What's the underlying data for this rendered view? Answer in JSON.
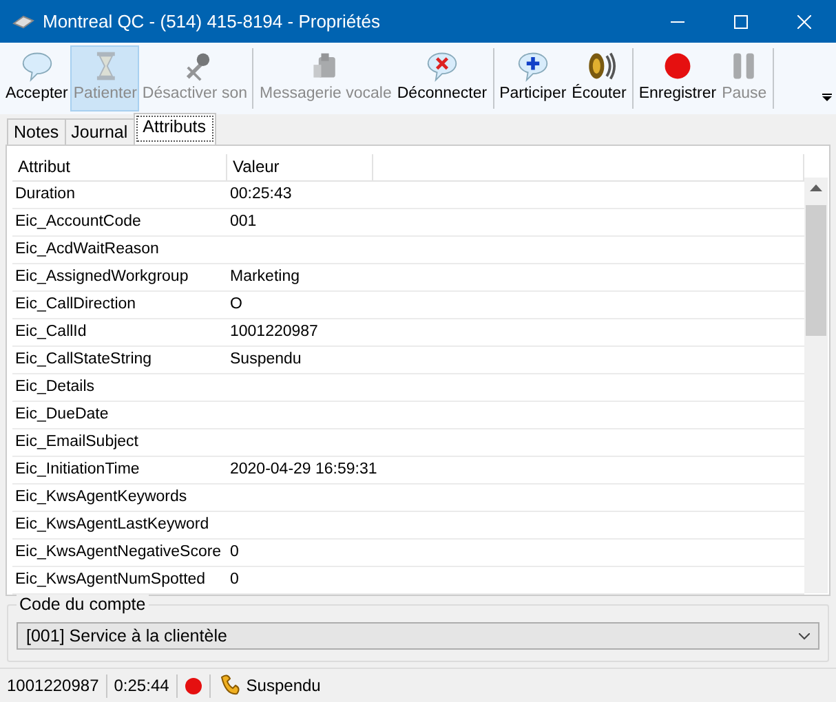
{
  "window": {
    "title": "Montreal QC - (514) 415-8194 - Propriétés"
  },
  "toolbar": [
    {
      "label": "Accepter",
      "disabled": false,
      "pressed": false,
      "separator_after": false
    },
    {
      "label": "Patienter",
      "disabled": true,
      "pressed": true,
      "separator_after": false
    },
    {
      "label": "Désactiver son",
      "disabled": true,
      "pressed": false,
      "separator_after": true
    },
    {
      "label": "Messagerie vocale",
      "disabled": true,
      "pressed": false,
      "separator_after": false
    },
    {
      "label": "Déconnecter",
      "disabled": false,
      "pressed": false,
      "separator_after": true
    },
    {
      "label": "Participer",
      "disabled": false,
      "pressed": false,
      "separator_after": false
    },
    {
      "label": "Écouter",
      "disabled": false,
      "pressed": false,
      "separator_after": true
    },
    {
      "label": "Enregistrer",
      "disabled": false,
      "pressed": false,
      "separator_after": false
    },
    {
      "label": "Pause",
      "disabled": true,
      "pressed": false,
      "separator_after": true
    }
  ],
  "tabs": [
    {
      "label": "Notes",
      "selected": false
    },
    {
      "label": "Journal",
      "selected": false
    },
    {
      "label": "Attributs",
      "selected": true
    }
  ],
  "table": {
    "columns": [
      "Attribut",
      "Valeur"
    ],
    "rows": [
      [
        "Duration",
        "00:25:43"
      ],
      [
        "Eic_AccountCode",
        "001"
      ],
      [
        "Eic_AcdWaitReason",
        ""
      ],
      [
        "Eic_AssignedWorkgroup",
        "Marketing"
      ],
      [
        "Eic_CallDirection",
        "O"
      ],
      [
        "Eic_CallId",
        "1001220987"
      ],
      [
        "Eic_CallStateString",
        "Suspendu"
      ],
      [
        "Eic_Details",
        ""
      ],
      [
        "Eic_DueDate",
        ""
      ],
      [
        "Eic_EmailSubject",
        ""
      ],
      [
        "Eic_InitiationTime",
        "2020-04-29 16:59:31"
      ],
      [
        "Eic_KwsAgentKeywords",
        ""
      ],
      [
        "Eic_KwsAgentLastKeyword",
        ""
      ],
      [
        "Eic_KwsAgentNegativeScore",
        "0"
      ],
      [
        "Eic_KwsAgentNumSpotted",
        "0"
      ]
    ]
  },
  "account_code": {
    "label": "Code du compte",
    "value": "[001]  Service à la clientèle"
  },
  "status_bar": {
    "call_id": "1001220987",
    "duration": "0:25:44",
    "state": "Suspendu"
  }
}
